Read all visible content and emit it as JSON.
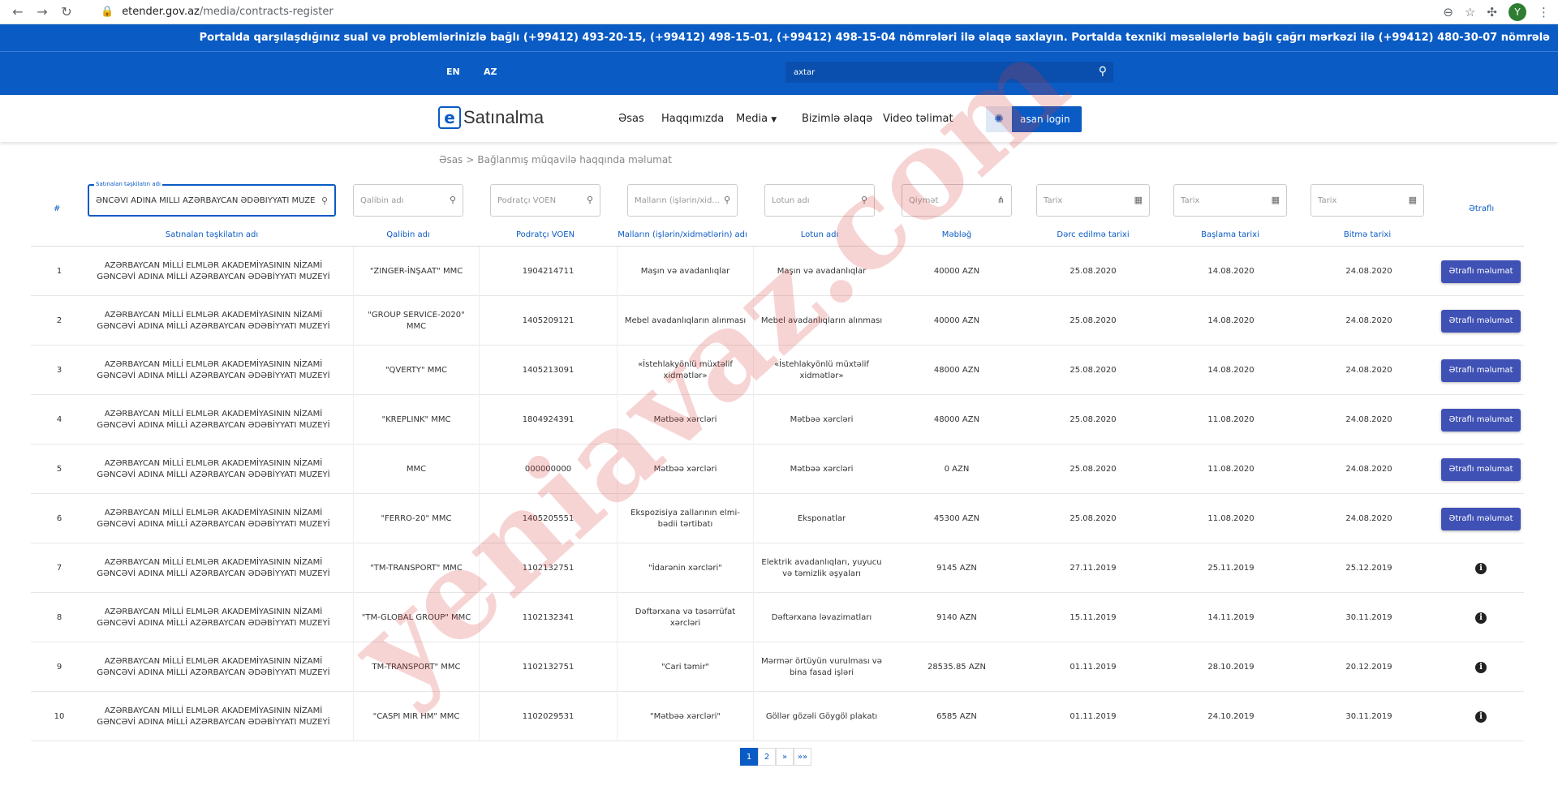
{
  "browser": {
    "url_host": "etender.gov.az",
    "url_path": "/media/contracts-register",
    "avatar_letter": "Y"
  },
  "ticker": "Portalda qarşılaşdığınız sual və problemlərinizlə bağlı (+99412) 493-20-15, (+99412) 498-15-01, (+99412) 498-15-04 nömrələri ilə əlaqə saxlayın. Portalda texniki məsələlərlə bağlı çağrı mərkəzi ilə (+99412) 480-30-07 nömrələ",
  "topbar": {
    "lang_en": "EN",
    "lang_az": "AZ",
    "search_placeholder": "axtar"
  },
  "nav": {
    "logo_letter": "e",
    "logo_text": "Satınalma",
    "items": [
      "Əsas",
      "Haqqımızda",
      "Media",
      "Bizimlə əlaqə",
      "Video təlimat"
    ],
    "login": "asan login"
  },
  "breadcrumb": {
    "home": "Əsas",
    "sep": ">",
    "current": "Bağlanmış müqavilə haqqında məlumat"
  },
  "filters": {
    "org_label": "Satınalan təşkilatın adı",
    "org_value": "ƏNCƏVİ ADINA MİLLİ AZƏRBAYCAN ƏDƏBİYYATI MUZEYİ",
    "template": "Qalibin adı",
    "voen": "Podratçı VOEN",
    "goods": "Malların (işlərin/xid...",
    "lot": "Lotun adı",
    "amount": "Qiymət",
    "date1": "Tarix",
    "date2": "Tarix",
    "date3": "Tarix",
    "hash": "#",
    "details": "Ətraflı"
  },
  "columns": [
    "Satınalan təşkilatın adı",
    "Qalibin adı",
    "Podratçı VOEN",
    "Malların (işlərin/xidmətlərin) adı",
    "Lotun adı",
    "Məbləğ",
    "Dərc edilmə tarixi",
    "Başlama tarixi",
    "Bitmə tarixi"
  ],
  "rows": [
    {
      "n": "1",
      "org": "AZƏRBAYCAN MİLLİ ELMLƏR AKADEMİYASININ NİZAMİ GƏNCƏVİ ADINA MİLLİ AZƏRBAYCAN ƏDƏBİYYATI MUZEYİ",
      "winner": "\"ZINGER-İNŞAAT\" MMC",
      "voen": "1904214711",
      "goods": "Maşın və avadanlıqlar",
      "lot": "Maşın və avadanlıqlar",
      "amount": "40000 AZN",
      "pub": "25.08.2020",
      "start": "14.08.2020",
      "end": "24.08.2020",
      "action": "button"
    },
    {
      "n": "2",
      "org": "AZƏRBAYCAN MİLLİ ELMLƏR AKADEMİYASININ NİZAMİ GƏNCƏVİ ADINA MİLLİ AZƏRBAYCAN ƏDƏBİYYATI MUZEYİ",
      "winner": "\"GROUP SERVICE-2020\" MMC",
      "voen": "1405209121",
      "goods": "Mebel avadanlıqların alınması",
      "lot": "Mebel avadanlıqların alınması",
      "amount": "40000 AZN",
      "pub": "25.08.2020",
      "start": "14.08.2020",
      "end": "24.08.2020",
      "action": "button"
    },
    {
      "n": "3",
      "org": "AZƏRBAYCAN MİLLİ ELMLƏR AKADEMİYASININ NİZAMİ GƏNCƏVİ ADINA MİLLİ AZƏRBAYCAN ƏDƏBİYYATI MUZEYİ",
      "winner": "\"QVERTY\" MMC",
      "voen": "1405213091",
      "goods": "«İstehlakyönlü müxtəlif xidmətlər»",
      "lot": "«İstehlakyönlü müxtəlif xidmətlər»",
      "amount": "48000 AZN",
      "pub": "25.08.2020",
      "start": "14.08.2020",
      "end": "24.08.2020",
      "action": "button"
    },
    {
      "n": "4",
      "org": "AZƏRBAYCAN MİLLİ ELMLƏR AKADEMİYASININ NİZAMİ GƏNCƏVİ ADINA MİLLİ AZƏRBAYCAN ƏDƏBİYYATI MUZEYİ",
      "winner": "\"KREPLINK\" MMC",
      "voen": "1804924391",
      "goods": "Mətbəə xərcləri",
      "lot": "Mətbəə xərcləri",
      "amount": "48000 AZN",
      "pub": "25.08.2020",
      "start": "11.08.2020",
      "end": "24.08.2020",
      "action": "button"
    },
    {
      "n": "5",
      "org": "AZƏRBAYCAN MİLLİ ELMLƏR AKADEMİYASININ NİZAMİ GƏNCƏVİ ADINA MİLLİ AZƏRBAYCAN ƏDƏBİYYATI MUZEYİ",
      "winner": "MMC",
      "voen": "000000000",
      "goods": "Mətbəə xərcləri",
      "lot": "Mətbəə xərcləri",
      "amount": "0 AZN",
      "pub": "25.08.2020",
      "start": "11.08.2020",
      "end": "24.08.2020",
      "action": "button"
    },
    {
      "n": "6",
      "org": "AZƏRBAYCAN MİLLİ ELMLƏR AKADEMİYASININ NİZAMİ GƏNCƏVİ ADINA MİLLİ AZƏRBAYCAN ƏDƏBİYYATI MUZEYİ",
      "winner": "\"FERRO-20\" MMC",
      "voen": "1405205551",
      "goods": "Ekspozisiya zallarının elmi-bədii tərtibatı",
      "lot": "Eksponatlar",
      "amount": "45300 AZN",
      "pub": "25.08.2020",
      "start": "11.08.2020",
      "end": "24.08.2020",
      "action": "button"
    },
    {
      "n": "7",
      "org": "AZƏRBAYCAN MİLLİ ELMLƏR AKADEMİYASININ NİZAMİ GƏNCƏVİ ADINA MİLLİ AZƏRBAYCAN ƏDƏBİYYATI MUZEYİ",
      "winner": "\"TM-TRANSPORT\" MMC",
      "voen": "1102132751",
      "goods": "\"İdarənin xərcləri\"",
      "lot": "Elektrik avadanlıqları, yuyucu və təmizlik əşyaları",
      "amount": "9145 AZN",
      "pub": "27.11.2019",
      "start": "25.11.2019",
      "end": "25.12.2019",
      "action": "info"
    },
    {
      "n": "8",
      "org": "AZƏRBAYCAN MİLLİ ELMLƏR AKADEMİYASININ NİZAMİ GƏNCƏVİ ADINA MİLLİ AZƏRBAYCAN ƏDƏBİYYATI MUZEYİ",
      "winner": "\"TM-GLOBAL GROUP\" MMC",
      "voen": "1102132341",
      "goods": "Dəftərxana və təsərrüfat xərcləri",
      "lot": "Dəftərxana ləvazimatları",
      "amount": "9140 AZN",
      "pub": "15.11.2019",
      "start": "14.11.2019",
      "end": "30.11.2019",
      "action": "info"
    },
    {
      "n": "9",
      "org": "AZƏRBAYCAN MİLLİ ELMLƏR AKADEMİYASININ NİZAMİ GƏNCƏVİ ADINA MİLLİ AZƏRBAYCAN ƏDƏBİYYATI MUZEYİ",
      "winner": "TM-TRANSPORT\" MMC",
      "voen": "1102132751",
      "goods": "\"Cari təmir\"",
      "lot": "Mərmər örtüyün vurulması və bina fasad işləri",
      "amount": "28535.85 AZN",
      "pub": "01.11.2019",
      "start": "28.10.2019",
      "end": "20.12.2019",
      "action": "info"
    },
    {
      "n": "10",
      "org": "AZƏRBAYCAN MİLLİ ELMLƏR AKADEMİYASININ NİZAMİ GƏNCƏVİ ADINA MİLLİ AZƏRBAYCAN ƏDƏBİYYATI MUZEYİ",
      "winner": "\"CASPI MIR HM\" MMC",
      "voen": "1102029531",
      "goods": "\"Mətbəə xərcləri\"",
      "lot": "Göllər gözəli Göygöl plakatı",
      "amount": "6585 AZN",
      "pub": "01.11.2019",
      "start": "24.10.2019",
      "end": "30.11.2019",
      "action": "info"
    }
  ],
  "detail_button_label": "Ətraflı məlumat",
  "info_glyph": "i",
  "pagination": [
    "1",
    "2",
    "»",
    "»»"
  ],
  "watermark": "yeniavaz.com",
  "colors": {
    "brand": "#0a5bc4",
    "button": "#3f51b5",
    "watermark": "#dc3c3c"
  }
}
